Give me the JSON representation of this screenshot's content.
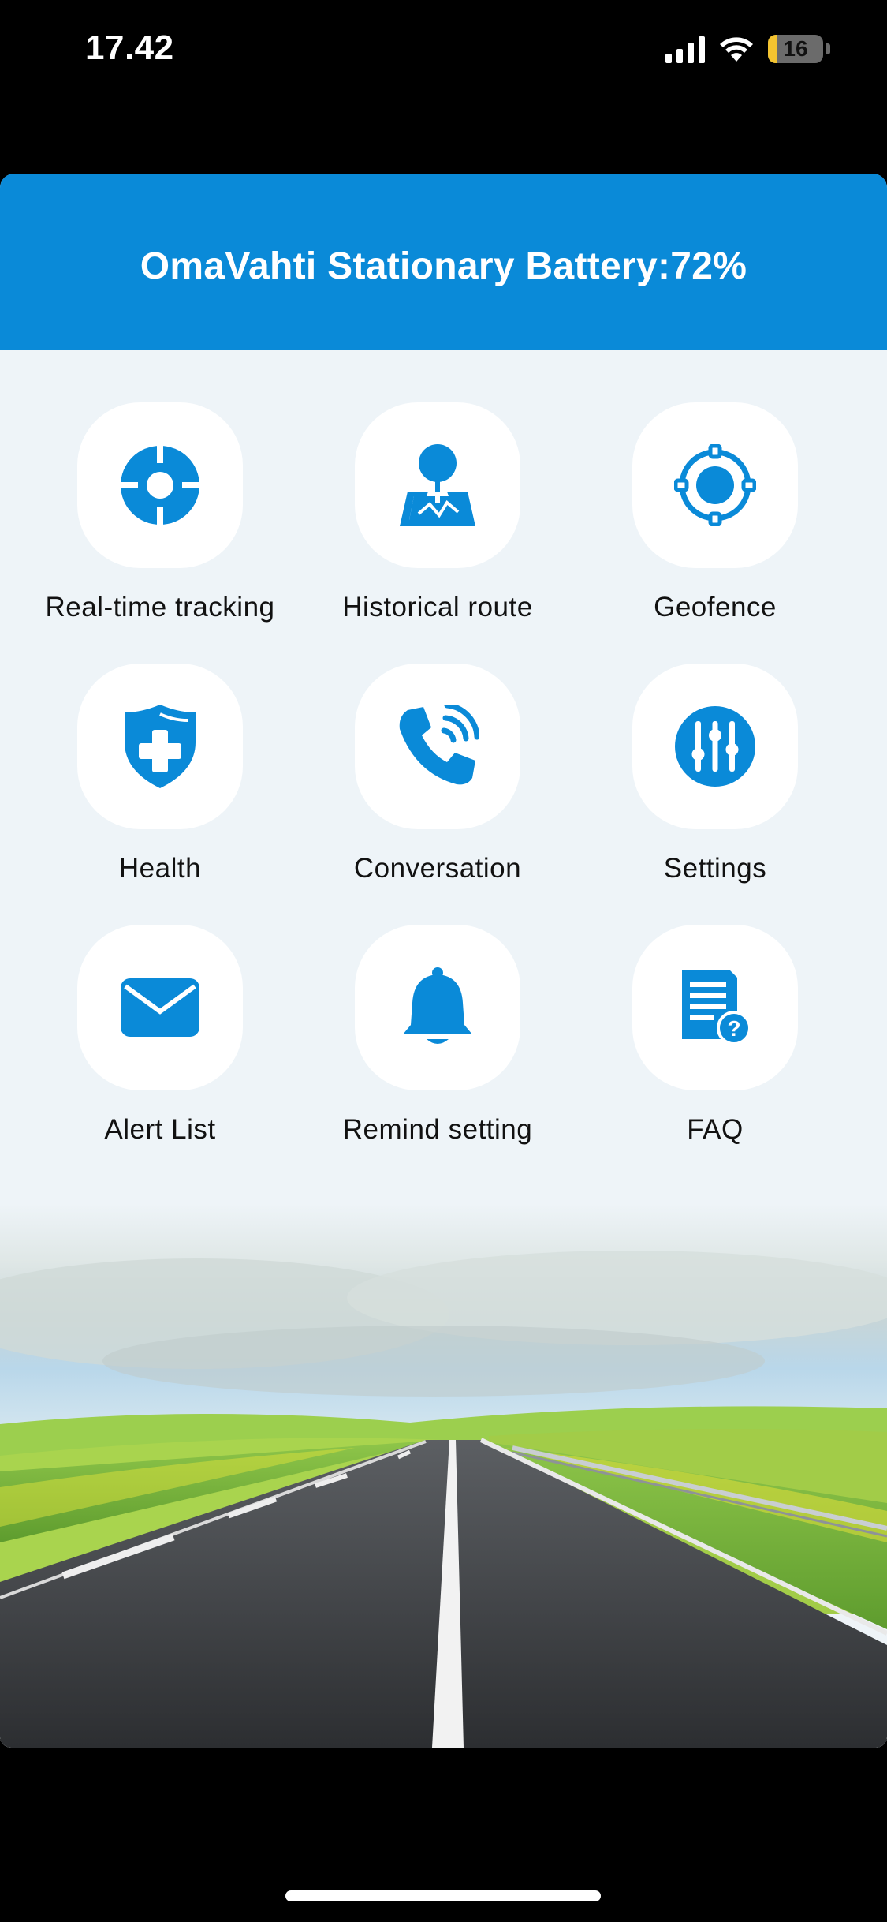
{
  "status_bar": {
    "time": "17.42",
    "battery_level": "16",
    "battery_fraction": 0.16,
    "battery_color": "#f4c430"
  },
  "header": {
    "title": "OmaVahti Stationary Battery:72%"
  },
  "colors": {
    "accent": "#0a8ad8",
    "tile_background": "#ffffff",
    "page_background": "#eef4f8"
  },
  "menu": {
    "items": [
      {
        "label": "Real-time tracking",
        "icon": "crosshair-target-icon"
      },
      {
        "label": "Historical route",
        "icon": "map-pin-icon"
      },
      {
        "label": "Geofence",
        "icon": "geofence-target-icon"
      },
      {
        "label": "Health",
        "icon": "health-shield-icon"
      },
      {
        "label": "Conversation",
        "icon": "phone-call-icon"
      },
      {
        "label": "Settings",
        "icon": "sliders-icon"
      },
      {
        "label": "Alert List",
        "icon": "envelope-icon"
      },
      {
        "label": "Remind setting",
        "icon": "bell-icon"
      },
      {
        "label": "FAQ",
        "icon": "document-question-icon"
      }
    ]
  }
}
